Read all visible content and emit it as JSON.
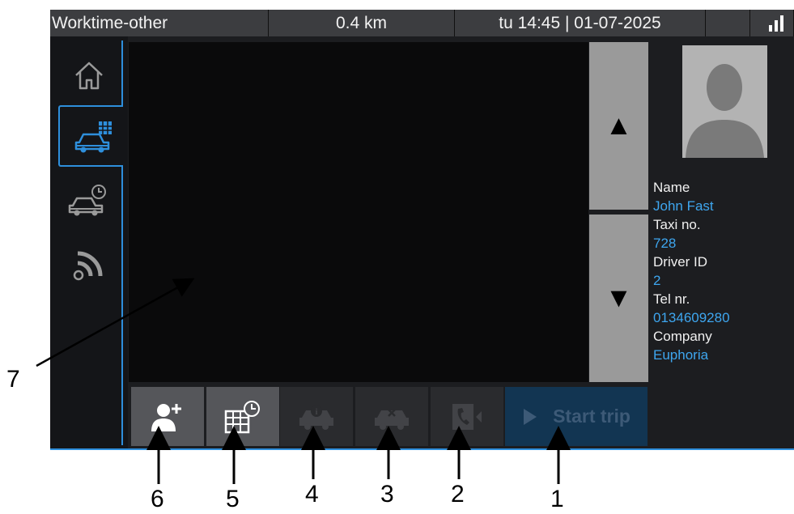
{
  "status_bar": {
    "title": "Worktime-other",
    "distance": "0.4 km",
    "datetime": "tu 14:45 | 01-07-2025",
    "signal_icon": "signal-bars-icon"
  },
  "sidebar": {
    "tabs": [
      {
        "icon": "home-icon"
      },
      {
        "icon": "car-schedule-icon",
        "active": true
      },
      {
        "icon": "car-clock-icon"
      },
      {
        "icon": "broadcast-icon"
      }
    ]
  },
  "scroll": {
    "up": "▲",
    "down": "▼"
  },
  "driver": {
    "name_label": "Name",
    "name": "John Fast",
    "taxi_label": "Taxi no.",
    "taxi": "728",
    "driver_id_label": "Driver ID",
    "driver_id": "2",
    "tel_label": "Tel nr.",
    "tel": "0134609280",
    "company_label": "Company",
    "company": "Euphoria"
  },
  "toolbar": {
    "buttons": [
      {
        "icon": "add-person-icon",
        "enabled": true
      },
      {
        "icon": "calendar-clock-icon",
        "enabled": true
      },
      {
        "icon": "car-info-icon",
        "enabled": false
      },
      {
        "icon": "car-cancel-icon",
        "enabled": false
      },
      {
        "icon": "phone-icon",
        "enabled": false
      }
    ],
    "start_trip": "Start trip"
  },
  "callouts": [
    "7",
    "6",
    "5",
    "4",
    "3",
    "2",
    "1"
  ],
  "colors": {
    "accent": "#2e8fdc",
    "value_text": "#3ea6ef"
  }
}
